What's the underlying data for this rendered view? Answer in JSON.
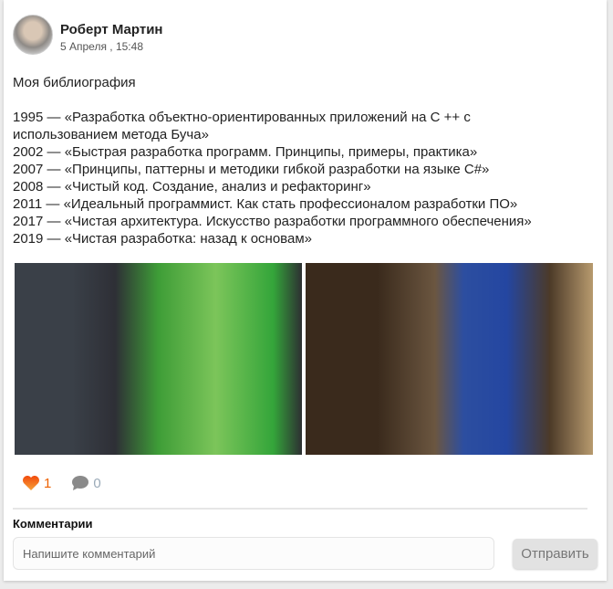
{
  "post": {
    "author": "Роберт Мартин",
    "date": "5 Апреля , 15:48",
    "title": "Моя библиография",
    "lines": [
      "1995 — «Разработка объектно-ориентированных приложений на С ++ с использованием метода Буча»",
      "2002 — «Быстрая разработка программ. Принципы, примеры, практика»",
      "2007 — «Принципы, паттерны и методики гибкой разработки на языке C#»",
      "2008 — «Чистый код. Создание, анализ и рефакторинг»",
      "2011 — «Идеальный программист. Как стать профессионалом разработки ПО»",
      "2017 — «Чистая архитектура. Искусство разработки программного обеспечения»",
      "2019 — «Чистая разработка: назад к основам»"
    ],
    "likes": "1",
    "comments": "0"
  },
  "comments_section": {
    "label": "Комментарии",
    "placeholder": "Напишите комментарий",
    "send_label": "Отправить"
  },
  "colors": {
    "like": "#ee6100",
    "comment_icon": "#8a8a8a"
  }
}
